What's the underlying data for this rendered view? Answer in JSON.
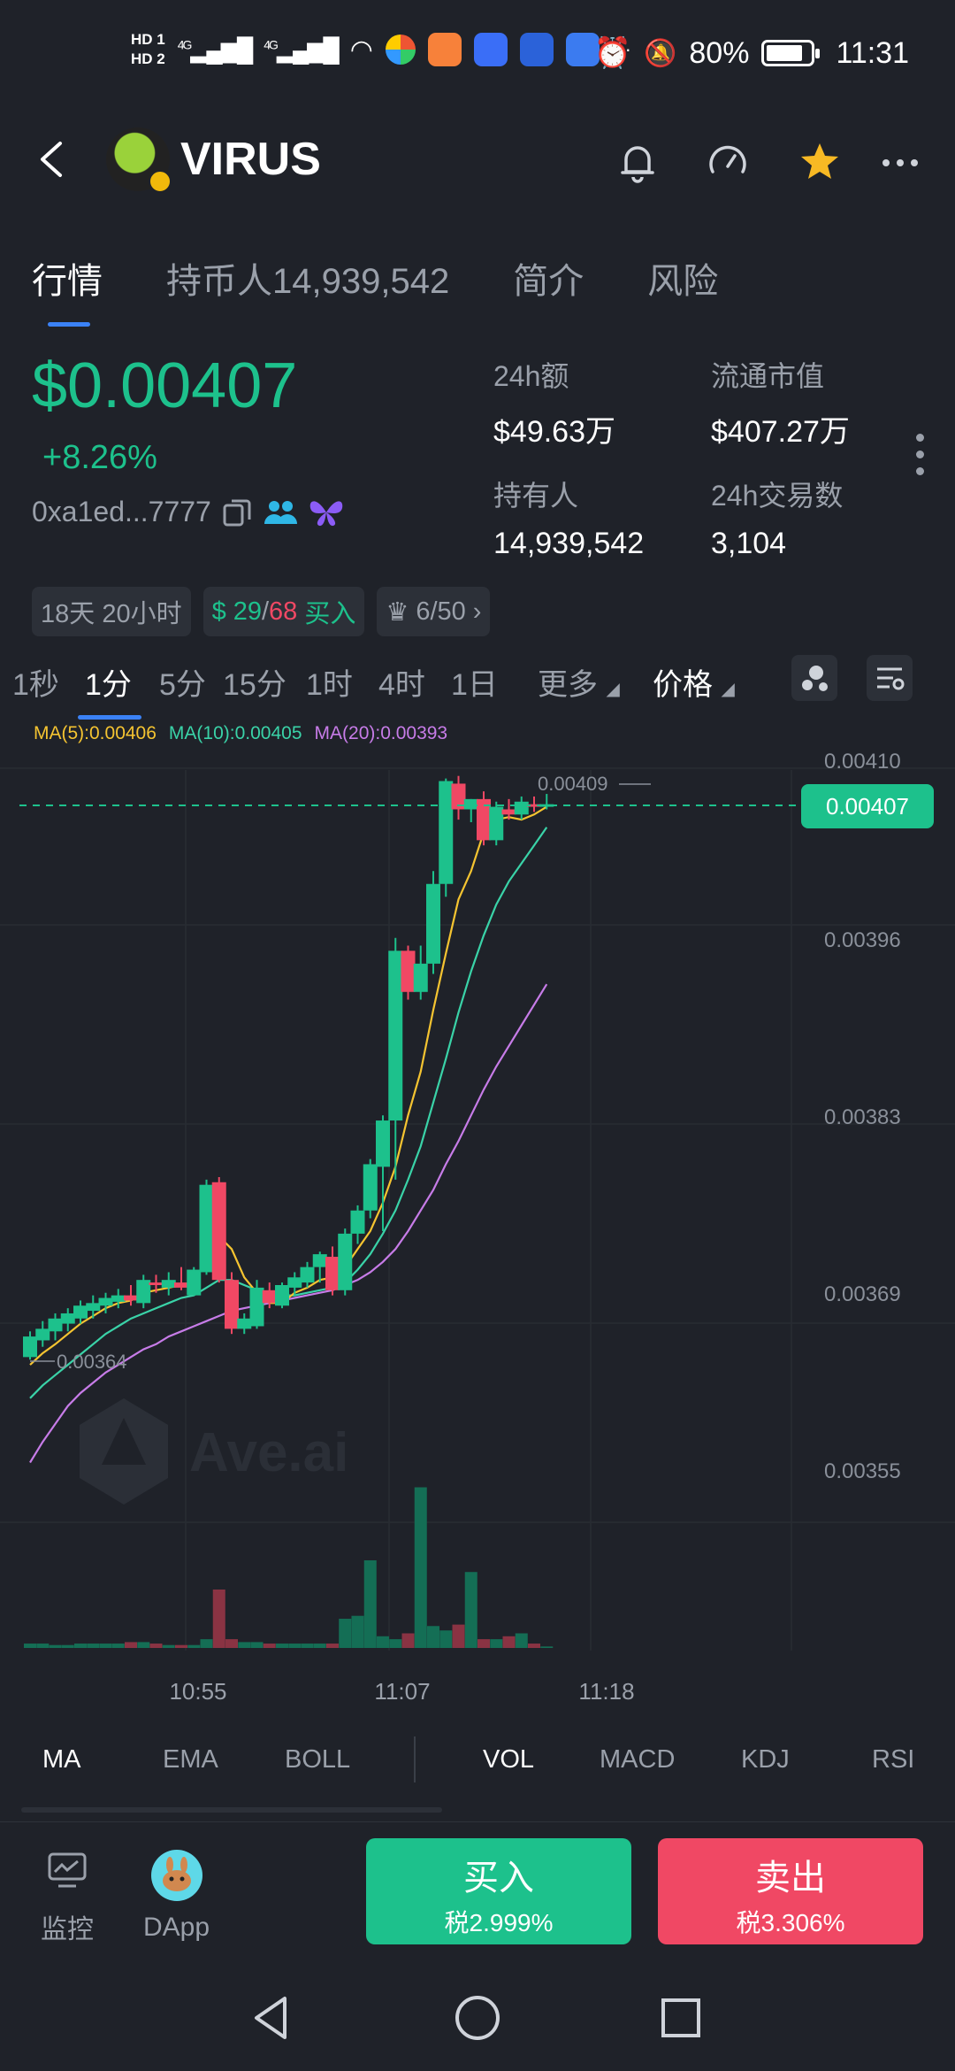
{
  "status_bar": {
    "time": "11:31",
    "battery": "80%",
    "network_1": "4G",
    "network_2": "4G",
    "hd1": "HD 1",
    "hd2": "HD 2",
    "more": "···"
  },
  "header": {
    "token_name": "VIRUS"
  },
  "tabs": [
    {
      "label": "行情",
      "active": true
    },
    {
      "label": "持币人14,939,542",
      "active": false
    },
    {
      "label": "简介",
      "active": false
    },
    {
      "label": "风险",
      "active": false
    }
  ],
  "price_block": {
    "price": "$0.00407",
    "change": "+8.26%",
    "contract": "0xa1ed...7777"
  },
  "stats": [
    {
      "label": "24h额",
      "value": "$49.63万"
    },
    {
      "label": "流通市值",
      "value": "$407.27万"
    },
    {
      "label": "持有人",
      "value": "14,939,542"
    },
    {
      "label": "24h交易数",
      "value": "3,104"
    }
  ],
  "chips": {
    "age": "18天 20小时",
    "buys": "29",
    "sells": "68",
    "buy_label": "买入",
    "top": "6/50"
  },
  "intervals": [
    "1秒",
    "1分",
    "5分",
    "15分",
    "1时",
    "4时",
    "1日"
  ],
  "interval_active": "1分",
  "more_label": "更多",
  "price_label": "价格",
  "ma_legend": {
    "ma5": "MA(5):0.00406",
    "ma10": "MA(10):0.00405",
    "ma20": "MA(20):0.00393"
  },
  "colors": {
    "up": "#1dc18c",
    "down": "#f04864",
    "ma5": "#f5c431",
    "ma10": "#3ad3a8",
    "ma20": "#c77ce8",
    "accent": "#3b82f6"
  },
  "chart_data": {
    "type": "candlestick",
    "y_ticks": [
      "0.00410",
      "0.00396",
      "0.00383",
      "0.00369",
      "0.00355"
    ],
    "x_ticks": [
      "10:55",
      "11:07",
      "11:18"
    ],
    "current_price": "0.00407",
    "high_label": "0.00409",
    "low_label": "0.00364",
    "watermark": "Ave.ai",
    "candles": [
      {
        "o": 0.003642,
        "h": 0.003662,
        "l": 0.00364,
        "c": 0.003658
      },
      {
        "o": 0.003655,
        "h": 0.00367,
        "l": 0.00365,
        "c": 0.003664
      },
      {
        "o": 0.003662,
        "h": 0.003676,
        "l": 0.003655,
        "c": 0.003672
      },
      {
        "o": 0.003668,
        "h": 0.00368,
        "l": 0.003662,
        "c": 0.003676
      },
      {
        "o": 0.003672,
        "h": 0.003686,
        "l": 0.003668,
        "c": 0.003682
      },
      {
        "o": 0.003678,
        "h": 0.00369,
        "l": 0.003672,
        "c": 0.003684
      },
      {
        "o": 0.003682,
        "h": 0.003692,
        "l": 0.003676,
        "c": 0.003688
      },
      {
        "o": 0.003685,
        "h": 0.003695,
        "l": 0.00368,
        "c": 0.00369
      },
      {
        "o": 0.00369,
        "h": 0.003698,
        "l": 0.003682,
        "c": 0.003686
      },
      {
        "o": 0.003684,
        "h": 0.003706,
        "l": 0.00368,
        "c": 0.003702
      },
      {
        "o": 0.0037,
        "h": 0.003706,
        "l": 0.003692,
        "c": 0.003698
      },
      {
        "o": 0.003696,
        "h": 0.003708,
        "l": 0.00369,
        "c": 0.003702
      },
      {
        "o": 0.0037,
        "h": 0.003712,
        "l": 0.003694,
        "c": 0.003696
      },
      {
        "o": 0.00369,
        "h": 0.003712,
        "l": 0.00369,
        "c": 0.00371
      },
      {
        "o": 0.003708,
        "h": 0.00378,
        "l": 0.003706,
        "c": 0.003776
      },
      {
        "o": 0.003778,
        "h": 0.003782,
        "l": 0.0037,
        "c": 0.003702
      },
      {
        "o": 0.003702,
        "h": 0.003708,
        "l": 0.00366,
        "c": 0.003664
      },
      {
        "o": 0.003664,
        "h": 0.003676,
        "l": 0.00366,
        "c": 0.003672
      },
      {
        "o": 0.003666,
        "h": 0.003702,
        "l": 0.003664,
        "c": 0.003696
      },
      {
        "o": 0.003694,
        "h": 0.0037,
        "l": 0.00368,
        "c": 0.003684
      },
      {
        "o": 0.003682,
        "h": 0.0037,
        "l": 0.00368,
        "c": 0.003698
      },
      {
        "o": 0.003696,
        "h": 0.003708,
        "l": 0.00369,
        "c": 0.003704
      },
      {
        "o": 0.0037,
        "h": 0.003716,
        "l": 0.003696,
        "c": 0.003712
      },
      {
        "o": 0.003712,
        "h": 0.003724,
        "l": 0.0037,
        "c": 0.003722
      },
      {
        "o": 0.00372,
        "h": 0.003728,
        "l": 0.00369,
        "c": 0.003694
      },
      {
        "o": 0.003694,
        "h": 0.003742,
        "l": 0.00369,
        "c": 0.003738
      },
      {
        "o": 0.003738,
        "h": 0.00376,
        "l": 0.00373,
        "c": 0.003756
      },
      {
        "o": 0.003756,
        "h": 0.003796,
        "l": 0.00375,
        "c": 0.003792
      },
      {
        "o": 0.00379,
        "h": 0.00383,
        "l": 0.00374,
        "c": 0.003826
      },
      {
        "o": 0.003826,
        "h": 0.003968,
        "l": 0.00378,
        "c": 0.003958
      },
      {
        "o": 0.003958,
        "h": 0.003962,
        "l": 0.00392,
        "c": 0.003926
      },
      {
        "o": 0.003926,
        "h": 0.003962,
        "l": 0.00392,
        "c": 0.003948
      },
      {
        "o": 0.003948,
        "h": 0.00402,
        "l": 0.00394,
        "c": 0.00401
      },
      {
        "o": 0.00401,
        "h": 0.004092,
        "l": 0.004,
        "c": 0.00409
      },
      {
        "o": 0.004088,
        "h": 0.004094,
        "l": 0.00406,
        "c": 0.004068
      },
      {
        "o": 0.004068,
        "h": 0.004076,
        "l": 0.004058,
        "c": 0.004076
      },
      {
        "o": 0.004076,
        "h": 0.004082,
        "l": 0.00404,
        "c": 0.004044
      },
      {
        "o": 0.004044,
        "h": 0.004074,
        "l": 0.00404,
        "c": 0.00407
      },
      {
        "o": 0.004068,
        "h": 0.004076,
        "l": 0.00406,
        "c": 0.004064
      },
      {
        "o": 0.004064,
        "h": 0.004078,
        "l": 0.00406,
        "c": 0.004074
      },
      {
        "o": 0.004072,
        "h": 0.004078,
        "l": 0.004066,
        "c": 0.00407
      },
      {
        "o": 0.00407,
        "h": 0.00408,
        "l": 0.004068,
        "c": 0.004072
      }
    ],
    "volumes": [
      3,
      3,
      2,
      2,
      3,
      3,
      3,
      3,
      4,
      4,
      3,
      2,
      2,
      2,
      6,
      40,
      6,
      4,
      4,
      3,
      3,
      3,
      3,
      3,
      3,
      20,
      22,
      60,
      8,
      6,
      10,
      110,
      15,
      12,
      16,
      52,
      6,
      6,
      8,
      10,
      3,
      1
    ],
    "ma5": [
      0.003636,
      0.003645,
      0.003652,
      0.00366,
      0.003668,
      0.003674,
      0.00368,
      0.003684,
      0.003686,
      0.003692,
      0.003694,
      0.003696,
      0.003698,
      0.0037,
      0.003718,
      0.003736,
      0.003726,
      0.003704,
      0.003692,
      0.003684,
      0.003684,
      0.003692,
      0.003696,
      0.003702,
      0.003704,
      0.003712,
      0.003726,
      0.00374,
      0.003762,
      0.00379,
      0.00383,
      0.003864,
      0.003912,
      0.003956,
      0.003998,
      0.00402,
      0.00405,
      0.00406,
      0.004062,
      0.00406,
      0.004064,
      0.00407
    ],
    "ma10": [
      0.00361,
      0.00362,
      0.003628,
      0.003636,
      0.003644,
      0.003652,
      0.00366,
      0.003666,
      0.003672,
      0.003676,
      0.00368,
      0.003684,
      0.003688,
      0.00369,
      0.003696,
      0.003702,
      0.003702,
      0.003698,
      0.003694,
      0.00369,
      0.00369,
      0.00369,
      0.003692,
      0.003694,
      0.003696,
      0.0037,
      0.00371,
      0.003722,
      0.003738,
      0.003756,
      0.00378,
      0.003806,
      0.00384,
      0.003874,
      0.00391,
      0.003942,
      0.00397,
      0.003994,
      0.004012,
      0.004026,
      0.00404,
      0.004054
    ],
    "ma20": [
      0.00356,
      0.003576,
      0.00359,
      0.003604,
      0.003614,
      0.003622,
      0.00363,
      0.003636,
      0.003642,
      0.003648,
      0.003652,
      0.003658,
      0.003662,
      0.003666,
      0.00367,
      0.003674,
      0.003678,
      0.00368,
      0.003682,
      0.003684,
      0.003686,
      0.003688,
      0.00369,
      0.003692,
      0.003694,
      0.003698,
      0.003702,
      0.003708,
      0.003716,
      0.003726,
      0.00374,
      0.003756,
      0.003772,
      0.003792,
      0.00381,
      0.00383,
      0.00385,
      0.003868,
      0.003884,
      0.0039,
      0.003916,
      0.003932
    ]
  },
  "indicators_main": [
    "MA",
    "EMA",
    "BOLL"
  ],
  "indicators_sub": [
    "VOL",
    "MACD",
    "KDJ",
    "RSI"
  ],
  "bottom": {
    "monitor": "监控",
    "dapp": "DApp",
    "buy_label": "买入",
    "buy_tax": "税2.999%",
    "sell_label": "卖出",
    "sell_tax": "税3.306%"
  }
}
